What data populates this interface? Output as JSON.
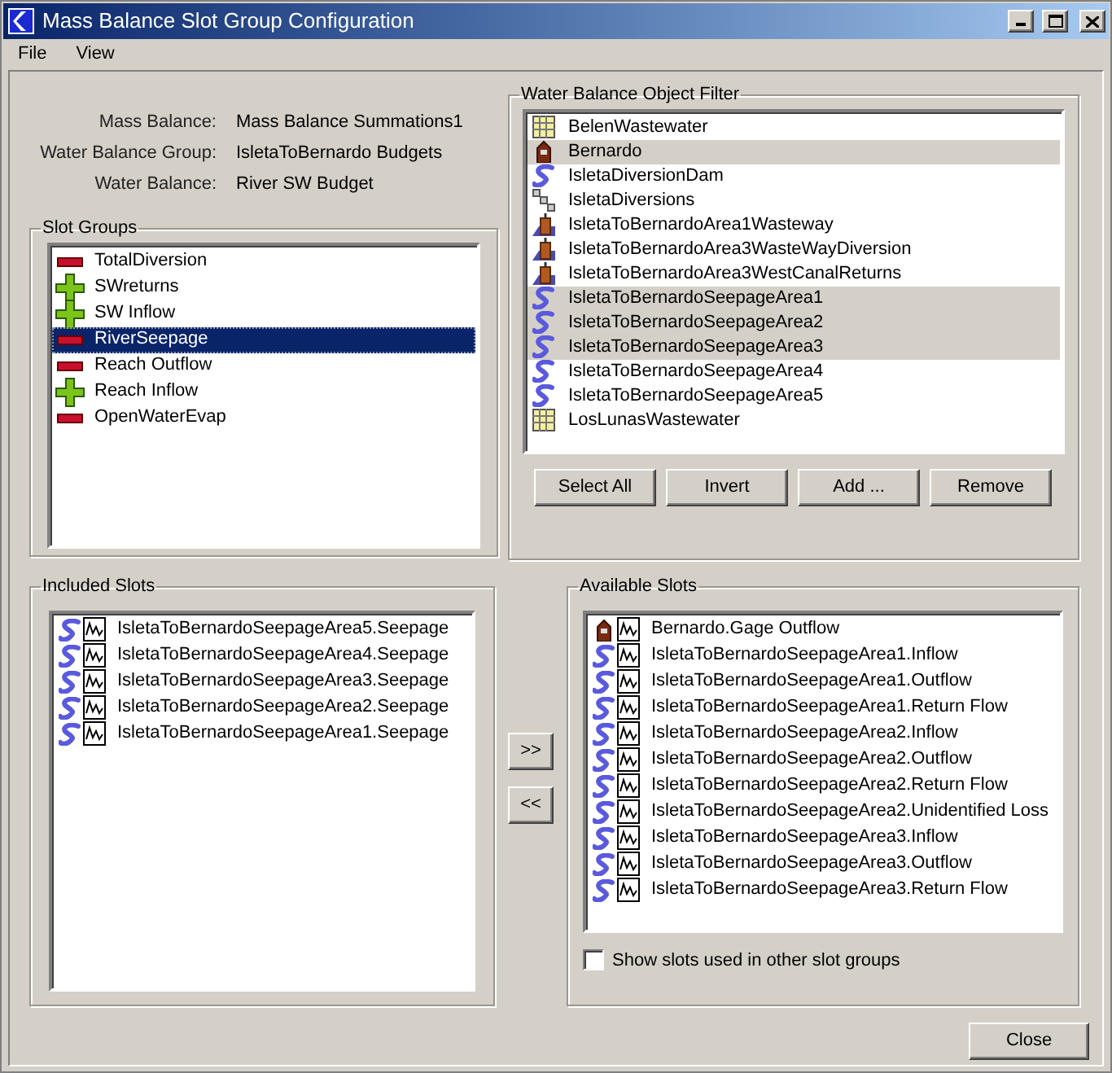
{
  "window": {
    "title": "Mass Balance Slot Group Configuration"
  },
  "menu": [
    "File",
    "View"
  ],
  "summary": [
    {
      "label": "Mass Balance:",
      "value": "Mass Balance Summations1"
    },
    {
      "label": "Water Balance Group:",
      "value": "IsletaToBernardo Budgets"
    },
    {
      "label": "Water Balance:",
      "value": "River SW Budget"
    }
  ],
  "slot_groups": {
    "title": "Slot Groups",
    "items": [
      {
        "name": "TotalDiversion",
        "kind": "minus",
        "selected": false
      },
      {
        "name": "SWreturns",
        "kind": "plus",
        "selected": false
      },
      {
        "name": "SW Inflow",
        "kind": "plus",
        "selected": false
      },
      {
        "name": "RiverSeepage",
        "kind": "minus",
        "selected": true
      },
      {
        "name": "Reach Outflow",
        "kind": "minus",
        "selected": false
      },
      {
        "name": "Reach Inflow",
        "kind": "plus",
        "selected": false
      },
      {
        "name": "OpenWaterEvap",
        "kind": "minus",
        "selected": false
      }
    ]
  },
  "object_filter": {
    "title": "Water Balance Object Filter",
    "items": [
      {
        "name": "BelenWastewater",
        "kind": "table",
        "selected": false
      },
      {
        "name": "Bernardo",
        "kind": "gage",
        "selected": true
      },
      {
        "name": "IsletaDiversionDam",
        "kind": "reach",
        "selected": false
      },
      {
        "name": "IsletaDiversions",
        "kind": "links",
        "selected": false
      },
      {
        "name": "IsletaToBernardoArea1Wasteway",
        "kind": "user",
        "selected": false
      },
      {
        "name": "IsletaToBernardoArea3WasteWayDiversion",
        "kind": "user",
        "selected": false
      },
      {
        "name": "IsletaToBernardoArea3WestCanalReturns",
        "kind": "user",
        "selected": false
      },
      {
        "name": "IsletaToBernardoSeepageArea1",
        "kind": "reach",
        "selected": true
      },
      {
        "name": "IsletaToBernardoSeepageArea2",
        "kind": "reach",
        "selected": true
      },
      {
        "name": "IsletaToBernardoSeepageArea3",
        "kind": "reach",
        "selected": true
      },
      {
        "name": "IsletaToBernardoSeepageArea4",
        "kind": "reach",
        "selected": false
      },
      {
        "name": "IsletaToBernardoSeepageArea5",
        "kind": "reach",
        "selected": false
      },
      {
        "name": "LosLunasWastewater",
        "kind": "table",
        "selected": false
      }
    ],
    "buttons": [
      "Select All",
      "Invert",
      "Add ...",
      "Remove"
    ]
  },
  "included_slots": {
    "title": "Included Slots",
    "items": [
      {
        "name": "IsletaToBernardoSeepageArea5.Seepage",
        "kind": "reach"
      },
      {
        "name": "IsletaToBernardoSeepageArea4.Seepage",
        "kind": "reach"
      },
      {
        "name": "IsletaToBernardoSeepageArea3.Seepage",
        "kind": "reach"
      },
      {
        "name": "IsletaToBernardoSeepageArea2.Seepage",
        "kind": "reach"
      },
      {
        "name": "IsletaToBernardoSeepageArea1.Seepage",
        "kind": "reach"
      }
    ]
  },
  "transfer_buttons": [
    ">>",
    "<<"
  ],
  "available_slots": {
    "title": "Available Slots",
    "items": [
      {
        "name": "Bernardo.Gage Outflow",
        "kind": "gage"
      },
      {
        "name": "IsletaToBernardoSeepageArea1.Inflow",
        "kind": "reach"
      },
      {
        "name": "IsletaToBernardoSeepageArea1.Outflow",
        "kind": "reach"
      },
      {
        "name": "IsletaToBernardoSeepageArea1.Return Flow",
        "kind": "reach"
      },
      {
        "name": "IsletaToBernardoSeepageArea2.Inflow",
        "kind": "reach"
      },
      {
        "name": "IsletaToBernardoSeepageArea2.Outflow",
        "kind": "reach"
      },
      {
        "name": "IsletaToBernardoSeepageArea2.Return Flow",
        "kind": "reach"
      },
      {
        "name": "IsletaToBernardoSeepageArea2.Unidentified Loss",
        "kind": "reach"
      },
      {
        "name": "IsletaToBernardoSeepageArea3.Inflow",
        "kind": "reach"
      },
      {
        "name": "IsletaToBernardoSeepageArea3.Outflow",
        "kind": "reach"
      },
      {
        "name": "IsletaToBernardoSeepageArea3.Return Flow",
        "kind": "reach"
      }
    ],
    "show_other": {
      "label": "Show slots used in other slot groups",
      "checked": false
    }
  },
  "close_button": "Close"
}
